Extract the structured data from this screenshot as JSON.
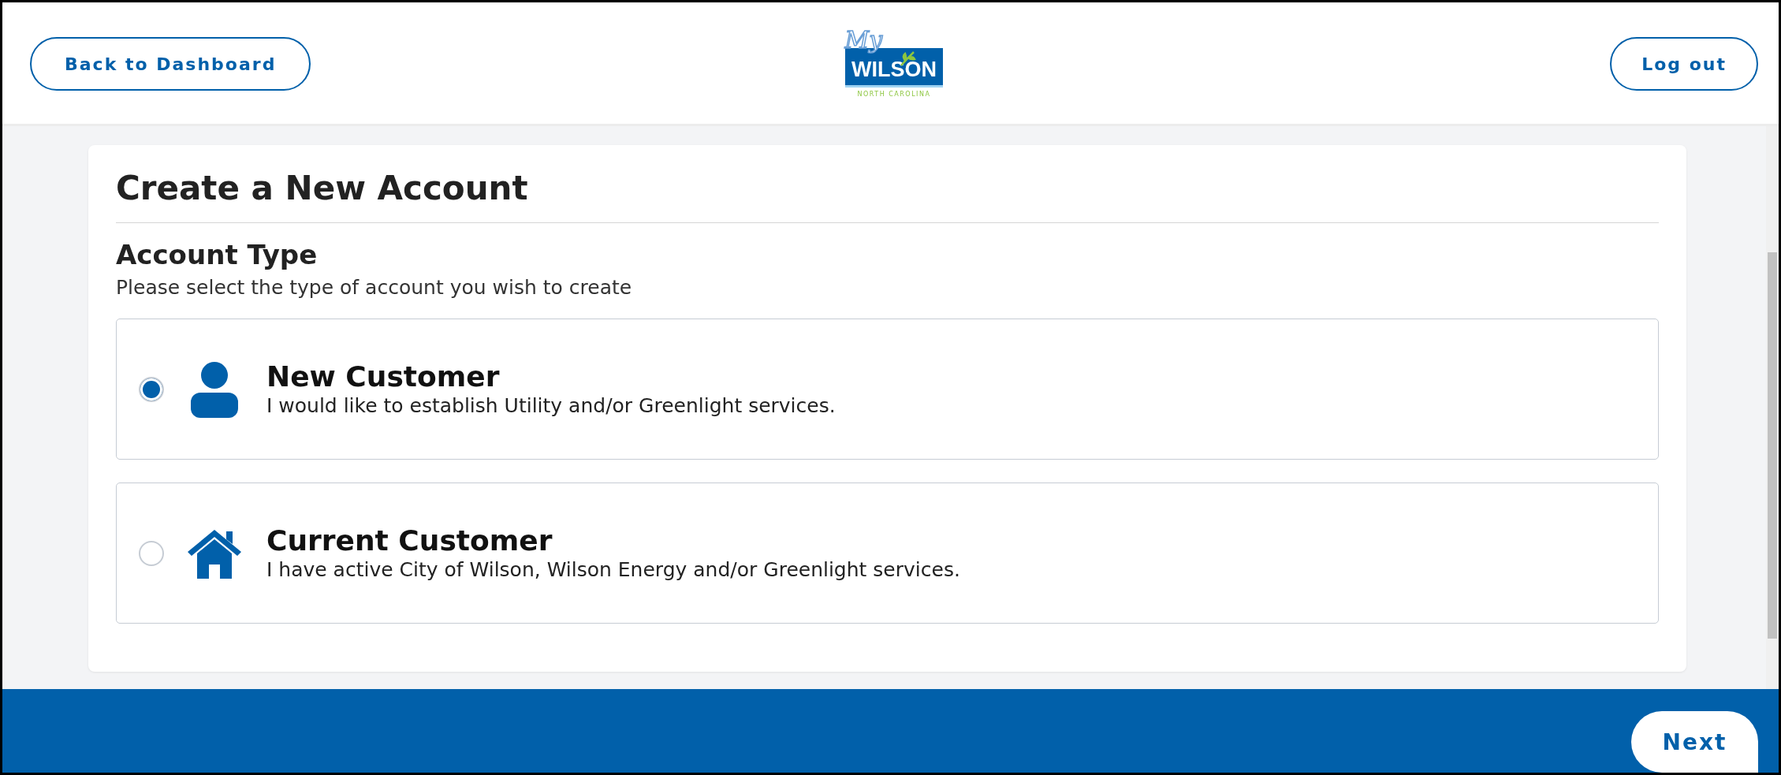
{
  "header": {
    "back_button": "Back to Dashboard",
    "logo": {
      "script": "My",
      "name": "WILSON",
      "region": "NORTH CAROLINA"
    },
    "logout_button": "Log out"
  },
  "form": {
    "title": "Create a New Account",
    "section_title": "Account Type",
    "instructions": "Please select the type of account you wish to create",
    "options": [
      {
        "kind": "person",
        "title": "New Customer",
        "description": "I would like to establish Utility and/or Greenlight services.",
        "selected": true
      },
      {
        "kind": "house",
        "title": "Current Customer",
        "description": "I have active City of Wilson, Wilson Energy and/or Greenlight services.",
        "selected": false
      }
    ]
  },
  "footer": {
    "next_button": "Next"
  }
}
